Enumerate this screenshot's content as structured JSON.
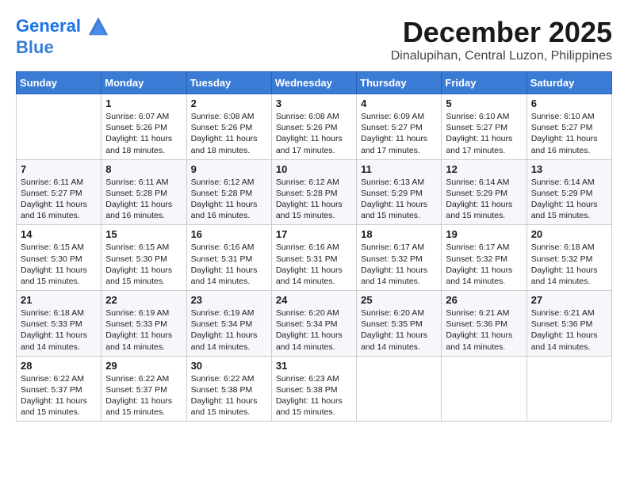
{
  "header": {
    "logo_line1": "General",
    "logo_line2": "Blue",
    "month": "December 2025",
    "location": "Dinalupihan, Central Luzon, Philippines"
  },
  "weekdays": [
    "Sunday",
    "Monday",
    "Tuesday",
    "Wednesday",
    "Thursday",
    "Friday",
    "Saturday"
  ],
  "weeks": [
    [
      {
        "day": "",
        "sunrise": "",
        "sunset": "",
        "daylight": ""
      },
      {
        "day": "1",
        "sunrise": "Sunrise: 6:07 AM",
        "sunset": "Sunset: 5:26 PM",
        "daylight": "Daylight: 11 hours and 18 minutes."
      },
      {
        "day": "2",
        "sunrise": "Sunrise: 6:08 AM",
        "sunset": "Sunset: 5:26 PM",
        "daylight": "Daylight: 11 hours and 18 minutes."
      },
      {
        "day": "3",
        "sunrise": "Sunrise: 6:08 AM",
        "sunset": "Sunset: 5:26 PM",
        "daylight": "Daylight: 11 hours and 17 minutes."
      },
      {
        "day": "4",
        "sunrise": "Sunrise: 6:09 AM",
        "sunset": "Sunset: 5:27 PM",
        "daylight": "Daylight: 11 hours and 17 minutes."
      },
      {
        "day": "5",
        "sunrise": "Sunrise: 6:10 AM",
        "sunset": "Sunset: 5:27 PM",
        "daylight": "Daylight: 11 hours and 17 minutes."
      },
      {
        "day": "6",
        "sunrise": "Sunrise: 6:10 AM",
        "sunset": "Sunset: 5:27 PM",
        "daylight": "Daylight: 11 hours and 16 minutes."
      }
    ],
    [
      {
        "day": "7",
        "sunrise": "Sunrise: 6:11 AM",
        "sunset": "Sunset: 5:27 PM",
        "daylight": "Daylight: 11 hours and 16 minutes."
      },
      {
        "day": "8",
        "sunrise": "Sunrise: 6:11 AM",
        "sunset": "Sunset: 5:28 PM",
        "daylight": "Daylight: 11 hours and 16 minutes."
      },
      {
        "day": "9",
        "sunrise": "Sunrise: 6:12 AM",
        "sunset": "Sunset: 5:28 PM",
        "daylight": "Daylight: 11 hours and 16 minutes."
      },
      {
        "day": "10",
        "sunrise": "Sunrise: 6:12 AM",
        "sunset": "Sunset: 5:28 PM",
        "daylight": "Daylight: 11 hours and 15 minutes."
      },
      {
        "day": "11",
        "sunrise": "Sunrise: 6:13 AM",
        "sunset": "Sunset: 5:29 PM",
        "daylight": "Daylight: 11 hours and 15 minutes."
      },
      {
        "day": "12",
        "sunrise": "Sunrise: 6:14 AM",
        "sunset": "Sunset: 5:29 PM",
        "daylight": "Daylight: 11 hours and 15 minutes."
      },
      {
        "day": "13",
        "sunrise": "Sunrise: 6:14 AM",
        "sunset": "Sunset: 5:29 PM",
        "daylight": "Daylight: 11 hours and 15 minutes."
      }
    ],
    [
      {
        "day": "14",
        "sunrise": "Sunrise: 6:15 AM",
        "sunset": "Sunset: 5:30 PM",
        "daylight": "Daylight: 11 hours and 15 minutes."
      },
      {
        "day": "15",
        "sunrise": "Sunrise: 6:15 AM",
        "sunset": "Sunset: 5:30 PM",
        "daylight": "Daylight: 11 hours and 15 minutes."
      },
      {
        "day": "16",
        "sunrise": "Sunrise: 6:16 AM",
        "sunset": "Sunset: 5:31 PM",
        "daylight": "Daylight: 11 hours and 14 minutes."
      },
      {
        "day": "17",
        "sunrise": "Sunrise: 6:16 AM",
        "sunset": "Sunset: 5:31 PM",
        "daylight": "Daylight: 11 hours and 14 minutes."
      },
      {
        "day": "18",
        "sunrise": "Sunrise: 6:17 AM",
        "sunset": "Sunset: 5:32 PM",
        "daylight": "Daylight: 11 hours and 14 minutes."
      },
      {
        "day": "19",
        "sunrise": "Sunrise: 6:17 AM",
        "sunset": "Sunset: 5:32 PM",
        "daylight": "Daylight: 11 hours and 14 minutes."
      },
      {
        "day": "20",
        "sunrise": "Sunrise: 6:18 AM",
        "sunset": "Sunset: 5:32 PM",
        "daylight": "Daylight: 11 hours and 14 minutes."
      }
    ],
    [
      {
        "day": "21",
        "sunrise": "Sunrise: 6:18 AM",
        "sunset": "Sunset: 5:33 PM",
        "daylight": "Daylight: 11 hours and 14 minutes."
      },
      {
        "day": "22",
        "sunrise": "Sunrise: 6:19 AM",
        "sunset": "Sunset: 5:33 PM",
        "daylight": "Daylight: 11 hours and 14 minutes."
      },
      {
        "day": "23",
        "sunrise": "Sunrise: 6:19 AM",
        "sunset": "Sunset: 5:34 PM",
        "daylight": "Daylight: 11 hours and 14 minutes."
      },
      {
        "day": "24",
        "sunrise": "Sunrise: 6:20 AM",
        "sunset": "Sunset: 5:34 PM",
        "daylight": "Daylight: 11 hours and 14 minutes."
      },
      {
        "day": "25",
        "sunrise": "Sunrise: 6:20 AM",
        "sunset": "Sunset: 5:35 PM",
        "daylight": "Daylight: 11 hours and 14 minutes."
      },
      {
        "day": "26",
        "sunrise": "Sunrise: 6:21 AM",
        "sunset": "Sunset: 5:36 PM",
        "daylight": "Daylight: 11 hours and 14 minutes."
      },
      {
        "day": "27",
        "sunrise": "Sunrise: 6:21 AM",
        "sunset": "Sunset: 5:36 PM",
        "daylight": "Daylight: 11 hours and 14 minutes."
      }
    ],
    [
      {
        "day": "28",
        "sunrise": "Sunrise: 6:22 AM",
        "sunset": "Sunset: 5:37 PM",
        "daylight": "Daylight: 11 hours and 15 minutes."
      },
      {
        "day": "29",
        "sunrise": "Sunrise: 6:22 AM",
        "sunset": "Sunset: 5:37 PM",
        "daylight": "Daylight: 11 hours and 15 minutes."
      },
      {
        "day": "30",
        "sunrise": "Sunrise: 6:22 AM",
        "sunset": "Sunset: 5:38 PM",
        "daylight": "Daylight: 11 hours and 15 minutes."
      },
      {
        "day": "31",
        "sunrise": "Sunrise: 6:23 AM",
        "sunset": "Sunset: 5:38 PM",
        "daylight": "Daylight: 11 hours and 15 minutes."
      },
      {
        "day": "",
        "sunrise": "",
        "sunset": "",
        "daylight": ""
      },
      {
        "day": "",
        "sunrise": "",
        "sunset": "",
        "daylight": ""
      },
      {
        "day": "",
        "sunrise": "",
        "sunset": "",
        "daylight": ""
      }
    ]
  ]
}
